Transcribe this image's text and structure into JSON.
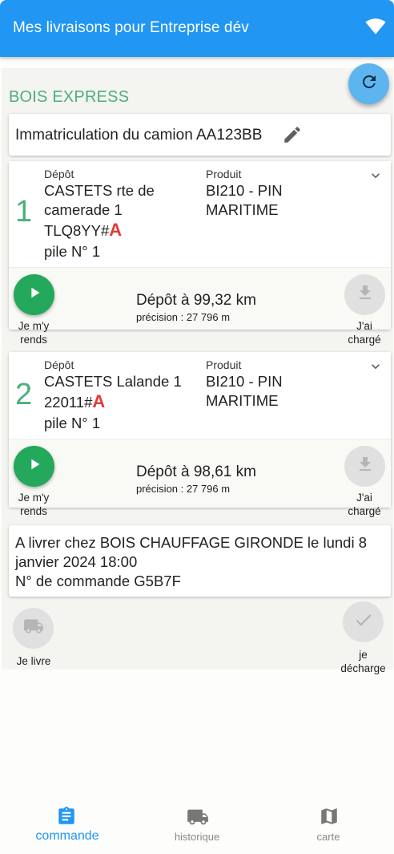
{
  "app": {
    "title": "Mes livraisons pour Entreprise dév",
    "wifi_icon": "wifi-icon",
    "accent": "#2196f3"
  },
  "order": {
    "supplier": "BOIS EXPRESS",
    "truck_plate": "Immatriculation du camion AA123BB",
    "depots": [
      {
        "index": "1",
        "depot_label": "Dépôt",
        "depot_lines": [
          "CASTETS rte de",
          "camerade 1"
        ],
        "code": "TLQ8YY#",
        "code_flag": "A",
        "pile": "pile N° 1",
        "product_label": "Produit",
        "product_lines": [
          "BI210 - PIN",
          "MARITIME"
        ],
        "go_label": [
          "Je m'y",
          "rends"
        ],
        "distance": "Dépôt à  99,32 km",
        "precision": "précision : 27 796 m",
        "loaded_label": [
          "J'ai",
          "chargé"
        ]
      },
      {
        "index": "2",
        "depot_label": "Dépôt",
        "depot_lines": [
          "CASTETS Lalande 1"
        ],
        "code": "22011#",
        "code_flag": "A",
        "pile": "pile N° 1",
        "product_label": "Produit",
        "product_lines": [
          "BI210 - PIN",
          "MARITIME"
        ],
        "go_label": [
          "Je m'y",
          "rends"
        ],
        "distance": "Dépôt à  98,61 km",
        "precision": "précision : 27 796 m",
        "loaded_label": [
          "J'ai",
          "chargé"
        ]
      }
    ],
    "delivery_text": "A livrer chez BOIS CHAUFFAGE GIRONDE le lundi 8 janvier 2024 18:00",
    "order_number": "N° de commande G5B7F",
    "deliver_label": "Je livre",
    "unload_label": [
      "je",
      "décharge"
    ]
  },
  "nav": {
    "items": [
      {
        "label": "commande",
        "icon": "clipboard-icon",
        "active": true
      },
      {
        "label": "historique",
        "icon": "truck-icon",
        "active": false
      },
      {
        "label": "carte",
        "icon": "map-icon",
        "active": false
      }
    ]
  }
}
